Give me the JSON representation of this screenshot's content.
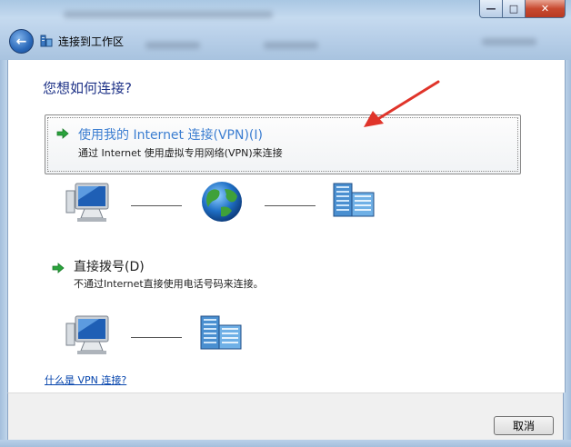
{
  "window": {
    "title": "连接到工作区",
    "controls": {
      "minimize": "—",
      "maximize": "□",
      "close": "✕"
    }
  },
  "page": {
    "question": "您想如何连接?"
  },
  "options": [
    {
      "title": "使用我的 Internet 连接(VPN)(I)",
      "description": "通过 Internet 使用虚拟专用网络(VPN)来连接"
    },
    {
      "title": "直接拨号(D)",
      "description": "不通过Internet直接使用电话号码来连接。"
    }
  ],
  "help_link": "什么是 VPN 连接?",
  "footer": {
    "cancel_label": "取消"
  },
  "colors": {
    "accent_link": "#0645ad",
    "question": "#1e3287",
    "option_highlight_title": "#3c7ed1",
    "annotation_arrow": "#e0342a",
    "green_arrow": "#2aa33c"
  },
  "icons": [
    "back-arrow-icon",
    "network-icon",
    "green-arrow-icon",
    "computer-icon",
    "globe-icon",
    "office-building-icon"
  ]
}
